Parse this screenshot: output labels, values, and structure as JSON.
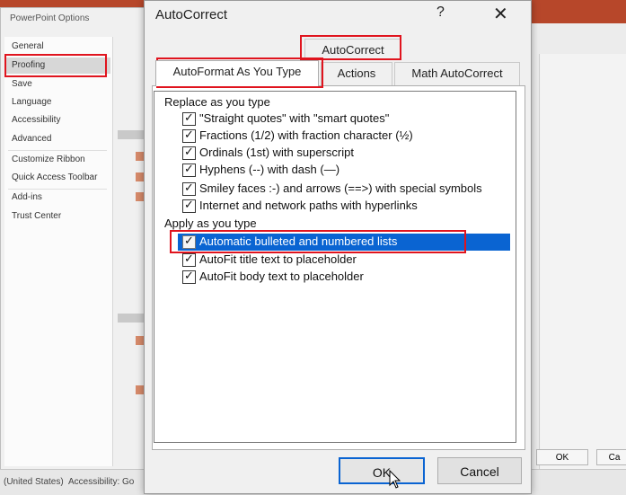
{
  "background": {
    "right_buttons": [
      "OK",
      "Ca"
    ]
  },
  "status_bar": {
    "language": "(United States)",
    "accessibility": "Accessibility: Go"
  },
  "options_window": {
    "title": "PowerPoint Options",
    "sidebar": [
      {
        "label": "General"
      },
      {
        "label": "Proofing",
        "selected": true
      },
      {
        "label": "Save"
      },
      {
        "label": "Language"
      },
      {
        "label": "Accessibility"
      },
      {
        "label": "Advanced"
      },
      {
        "label": "Customize Ribbon"
      },
      {
        "label": "Quick Access Toolbar"
      },
      {
        "label": "Add-ins"
      },
      {
        "label": "Trust Center"
      }
    ]
  },
  "dialog": {
    "title": "AutoCorrect",
    "help": "?",
    "close": "✕",
    "tabs": {
      "top": "AutoCorrect",
      "autoformat": "AutoFormat As You Type",
      "actions": "Actions",
      "math": "Math AutoCorrect"
    },
    "replace_heading": "Replace as you type",
    "replace_items": [
      {
        "label": "\"Straight quotes\" with \"smart quotes\"",
        "checked": true
      },
      {
        "label": "Fractions (1/2) with fraction character (½)",
        "checked": true
      },
      {
        "label": "Ordinals (1st) with superscript",
        "checked": true
      },
      {
        "label": "Hyphens (--) with dash (—)",
        "checked": true
      },
      {
        "label": "Smiley faces :-) and arrows (==>) with special symbols",
        "checked": true
      },
      {
        "label": "Internet and network paths with hyperlinks",
        "checked": true
      }
    ],
    "apply_heading": "Apply as you type",
    "apply_items": [
      {
        "label": "Automatic bulleted and numbered lists",
        "checked": true,
        "selected": true
      },
      {
        "label": "AutoFit title text to placeholder",
        "checked": true
      },
      {
        "label": "AutoFit body text to placeholder",
        "checked": true
      }
    ],
    "ok_label": "OK",
    "cancel_label": "Cancel"
  },
  "colors": {
    "highlight": "#0a64d2",
    "annotation": "#e0141e"
  }
}
